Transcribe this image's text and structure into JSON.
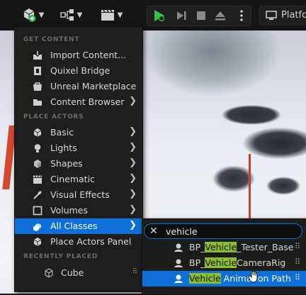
{
  "toolbar": {
    "add_button_icon": "cube-add-icon",
    "blueprint_button_icon": "blueprint-icon",
    "cinematics_button_icon": "clapperboard-icon",
    "play_controls": [
      "play-icon",
      "step-icon",
      "stop-icon",
      "eject-icon",
      "more-icon"
    ],
    "platforms_label": "Platfo"
  },
  "menu": {
    "sections": {
      "get_content": "GET CONTENT",
      "place_actors": "PLACE ACTORS",
      "recently_placed": "RECENTLY PLACED"
    },
    "get_content_items": [
      {
        "label": "Import Content...",
        "icon": "import-icon"
      },
      {
        "label": "Quixel Bridge",
        "icon": "quixel-bridge-icon"
      },
      {
        "label": "Unreal Marketplace",
        "icon": "marketplace-icon"
      },
      {
        "label": "Content Browser",
        "icon": "content-browser-icon"
      }
    ],
    "place_actor_items": [
      {
        "label": "Basic",
        "icon": "basic-icon"
      },
      {
        "label": "Lights",
        "icon": "lights-icon"
      },
      {
        "label": "Shapes",
        "icon": "shapes-icon"
      },
      {
        "label": "Cinematic",
        "icon": "cinematic-icon"
      },
      {
        "label": "Visual Effects",
        "icon": "visual-effects-icon"
      },
      {
        "label": "Volumes",
        "icon": "volumes-icon"
      },
      {
        "label": "All Classes",
        "icon": "all-classes-icon"
      },
      {
        "label": "Place Actors Panel",
        "icon": "place-actors-panel-icon"
      }
    ],
    "recent_items": [
      {
        "label": "Cube",
        "icon": "cube-icon"
      }
    ]
  },
  "submenu": {
    "search_value": "vehicle",
    "results": [
      {
        "prefix": "BP_",
        "match": "Vehicle",
        "suffix": "_Tester_Base",
        "icon": "blueprint-actor-icon"
      },
      {
        "prefix": "BP_",
        "match": "Vehicle",
        "suffix": "CameraRig",
        "icon": "blueprint-actor-icon"
      },
      {
        "prefix": "",
        "match": "Vehicle",
        "suffix": " Animation Path",
        "icon": "actor-class-icon"
      }
    ]
  },
  "colors": {
    "accent": "#0e6fd8",
    "highlight": "#8bbd2c",
    "play_green": "#36c24b"
  }
}
